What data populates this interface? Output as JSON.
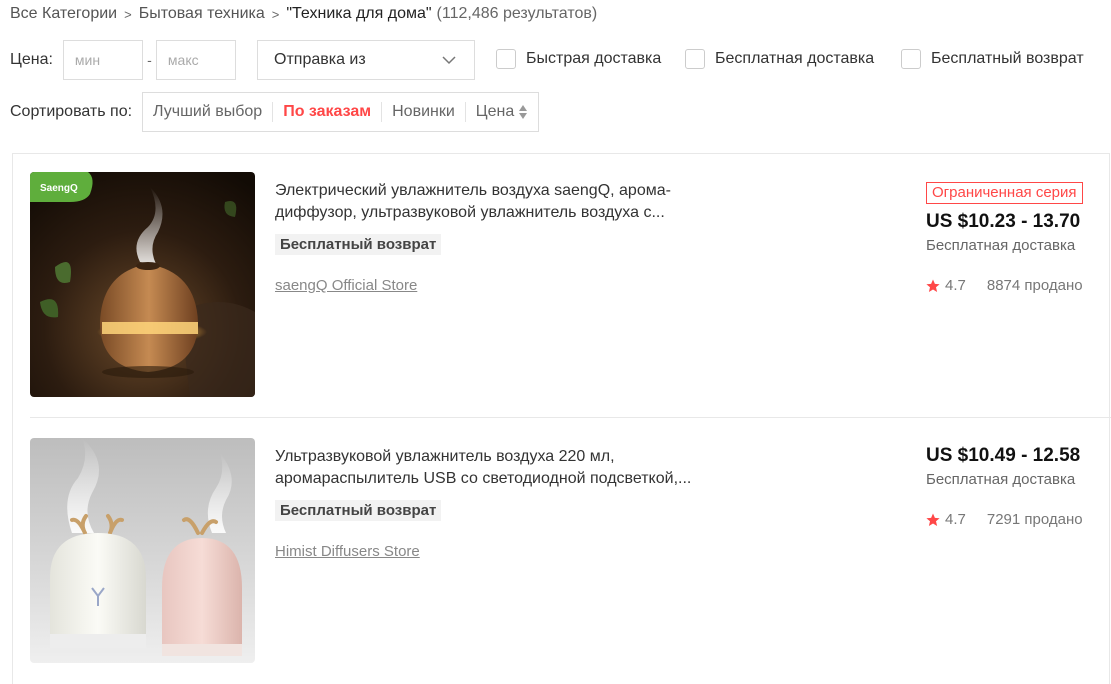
{
  "breadcrumb": {
    "items": [
      "Все Категории",
      "Бытовая техника"
    ],
    "current": "\"Техника для дома\"",
    "count": "(112,486 результатов)"
  },
  "filters": {
    "price_label": "Цена:",
    "min_placeholder": "мин",
    "max_placeholder": "макс",
    "dash": "-",
    "ship_from": "Отправка из",
    "fast_delivery": "Быстрая доставка",
    "free_delivery": "Бесплатная доставка",
    "free_return": "Бесплатный возврат"
  },
  "sort": {
    "label": "Сортировать по:",
    "options": [
      "Лучший выбор",
      "По заказам",
      "Новинки",
      "Цена"
    ],
    "active": "По заказам"
  },
  "products": [
    {
      "title": "Электрический увлажнитель воздуха saengQ, арома-диффузор, ультразвуковой увлажнитель воздуха с...",
      "title_line1": "Электрический увлажнитель воздуха saengQ, арома-",
      "title_line2": "диффузор, ультразвуковой увлажнитель воздуха с...",
      "badge": "Бесплатный возврат",
      "store": "saengQ Official Store",
      "limited": "Ограниченная серия",
      "price": "US $10.23 - 13.70",
      "shipping": "Бесплатная доставка",
      "rating": "4.7",
      "sold": "8874 продано",
      "logo_text": "SaengQ"
    },
    {
      "title": "Ультразвуковой увлажнитель воздуха 220 мл, аромараспылитель USB со светодиодной подсветкой,...",
      "title_line1": "Ультразвуковой увлажнитель воздуха 220 мл,",
      "title_line2": "аромараспылитель USB со светодиодной подсветкой,...",
      "badge": "Бесплатный возврат",
      "store": "Himist Diffusers Store",
      "price": "US $10.49 - 12.58",
      "shipping": "Бесплатная доставка",
      "rating": "4.7",
      "sold": "7291 продано"
    }
  ],
  "colors": {
    "accent": "#ff4747",
    "border": "#dddddd",
    "text": "#333333"
  }
}
